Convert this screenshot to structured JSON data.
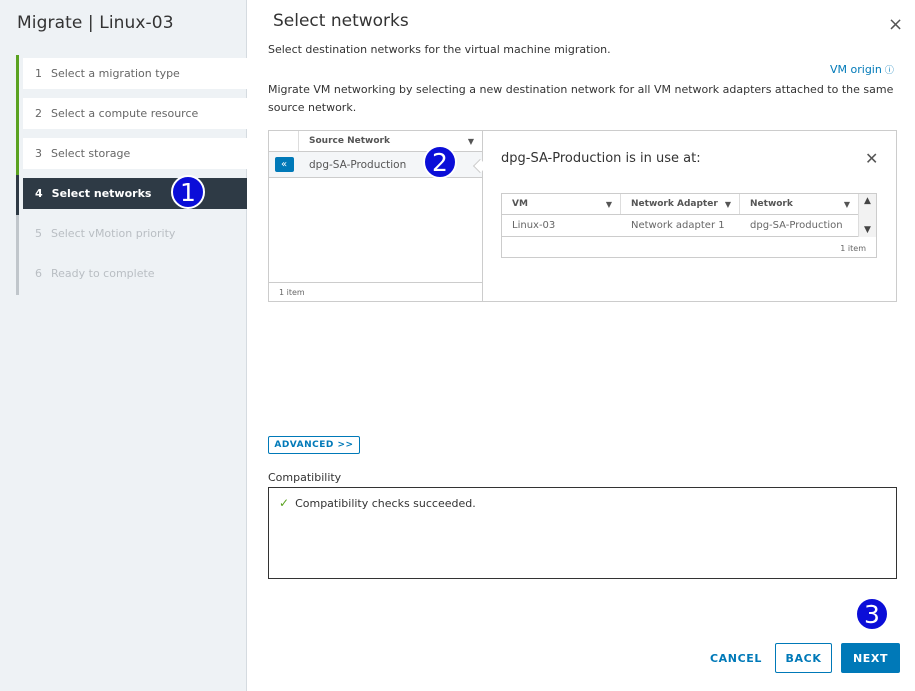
{
  "sidebar": {
    "title": "Migrate | Linux-03",
    "steps": [
      {
        "num": "1",
        "label": "Select a migration type"
      },
      {
        "num": "2",
        "label": "Select a compute resource"
      },
      {
        "num": "3",
        "label": "Select storage"
      },
      {
        "num": "4",
        "label": "Select networks"
      },
      {
        "num": "5",
        "label": "Select vMotion priority"
      },
      {
        "num": "6",
        "label": "Ready to complete"
      }
    ]
  },
  "badges": [
    "1",
    "2",
    "3"
  ],
  "main": {
    "title": "Select networks",
    "close_icon": "×",
    "subtitle": "Select destination networks for the virtual machine migration.",
    "vm_origin": "VM origin",
    "description": "Migrate VM networking by selecting a new destination network for all VM network adapters attached to the same source network."
  },
  "source_grid": {
    "header": "Source Network",
    "rows": [
      {
        "name": "dpg-SA-Production"
      }
    ],
    "footer": "1 item"
  },
  "detail": {
    "title": "dpg-SA-Production is in use at:",
    "columns": [
      "VM",
      "Network Adapter",
      "Network"
    ],
    "rows": [
      {
        "vm": "Linux-03",
        "adapter": "Network adapter 1",
        "network": "dpg-SA-Production"
      }
    ],
    "footer": "1 item"
  },
  "advanced_label": "ADVANCED >>",
  "compatibility": {
    "label": "Compatibility",
    "message": "Compatibility checks succeeded."
  },
  "footer": {
    "cancel": "CANCEL",
    "back": "BACK",
    "next": "NEXT"
  },
  "colors": {
    "accent": "#0079b8",
    "success": "#5aa220",
    "active_step": "#2e3a45",
    "badge": "#0b0ed8"
  },
  "icons": [
    "close-icon",
    "info-icon",
    "filter-icon",
    "collapse-double-left-icon",
    "check-icon",
    "scroll-up-icon",
    "scroll-down-icon"
  ]
}
